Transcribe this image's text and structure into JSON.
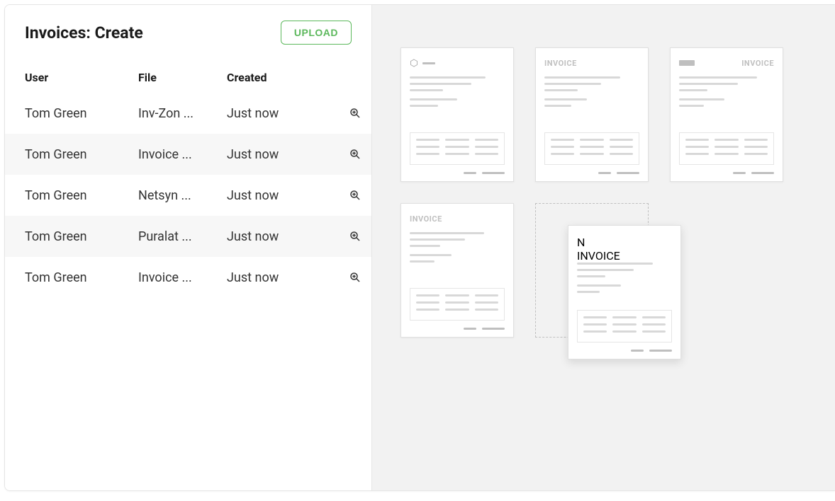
{
  "header": {
    "title": "Invoices: Create",
    "upload_label": "UPLOAD"
  },
  "table": {
    "columns": {
      "user": "User",
      "file": "File",
      "created": "Created"
    },
    "rows": [
      {
        "user": "Tom Green",
        "file": "Inv-Zon ...",
        "created": "Just now"
      },
      {
        "user": "Tom Green",
        "file": "Invoice ...",
        "created": "Just now"
      },
      {
        "user": "Tom Green",
        "file": "Netsyn ...",
        "created": "Just now"
      },
      {
        "user": "Tom Green",
        "file": "Puralat ...",
        "created": "Just now"
      },
      {
        "user": "Tom Green",
        "file": "Invoice ...",
        "created": "Just now"
      }
    ]
  },
  "thumbs": {
    "invoice_label": "INVOICE",
    "drag_letter": "N"
  }
}
